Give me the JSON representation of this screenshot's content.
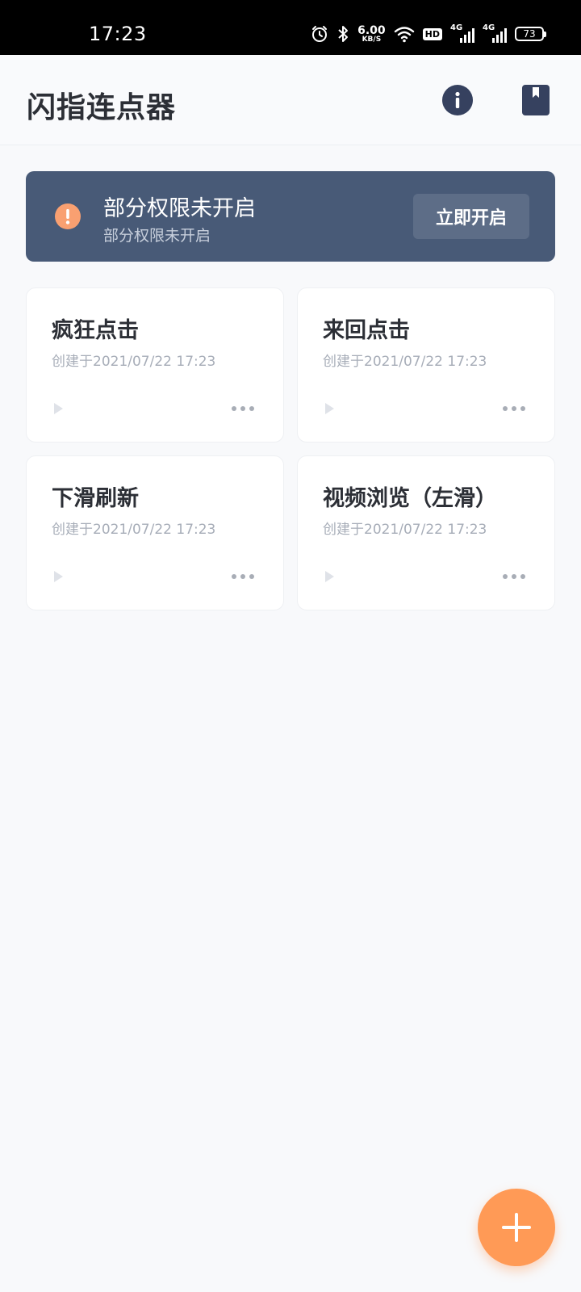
{
  "status_bar": {
    "time": "17:23",
    "speed_value": "6.00",
    "speed_unit": "KB/S",
    "hd_label": "HD",
    "net1_label": "4G",
    "net2_label": "4G",
    "battery": "73",
    "icons": [
      "alarm-icon",
      "bluetooth-icon",
      "wifi-icon",
      "hd-icon",
      "signal-icon",
      "signal-icon",
      "battery-icon"
    ]
  },
  "header": {
    "title": "闪指连点器",
    "icons": [
      "info-icon",
      "bookmark-icon"
    ]
  },
  "banner": {
    "title": "部分权限未开启",
    "subtitle": "部分权限未开启",
    "button_label": "立即开启",
    "icon": "warning-icon"
  },
  "tasks": [
    {
      "title": "疯狂点击",
      "created": "创建于2021/07/22 17:23"
    },
    {
      "title": "来回点击",
      "created": "创建于2021/07/22 17:23"
    },
    {
      "title": "下滑刷新",
      "created": "创建于2021/07/22 17:23"
    },
    {
      "title": "视频浏览（左滑）",
      "created": "创建于2021/07/22 17:23"
    }
  ],
  "fab": {
    "icon": "plus-icon"
  },
  "colors": {
    "banner_bg": "#485a77",
    "banner_button_bg": "#5d6d87",
    "warning": "#f9a071",
    "fab": "#ff9a56",
    "header_icon": "#36415f"
  }
}
